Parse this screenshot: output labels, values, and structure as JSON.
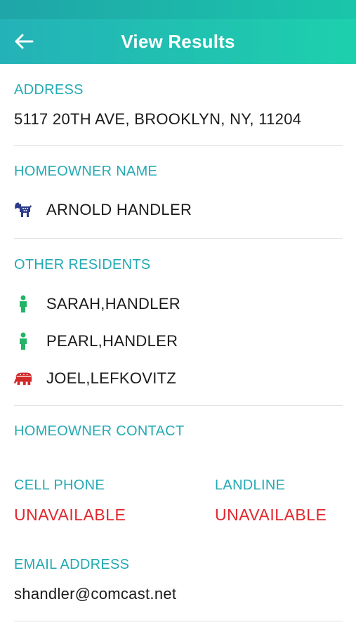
{
  "header": {
    "title": "View Results"
  },
  "address": {
    "label": "ADDRESS",
    "value": "5117 20TH AVE, BROOKLYN, NY, 11204"
  },
  "homeowner": {
    "label": "HOMEOWNER NAME",
    "name": "ARNOLD HANDLER",
    "party_icon": "democrat-donkey-icon"
  },
  "other_residents": {
    "label": "OTHER RESIDENTS",
    "items": [
      {
        "name": "SARAH,HANDLER",
        "icon": "person-icon"
      },
      {
        "name": "PEARL,HANDLER",
        "icon": "person-icon"
      },
      {
        "name": "JOEL,LEFKOVITZ",
        "icon": "republican-elephant-icon"
      }
    ]
  },
  "contact": {
    "label": "HOMEOWNER CONTACT",
    "cell_label": "CELL PHONE",
    "cell_value": "UNAVAILABLE",
    "landline_label": "LANDLINE",
    "landline_value": "UNAVAILABLE",
    "email_label": "EMAIL ADDRESS",
    "email_value": "shandler@comcast.net"
  },
  "colors": {
    "accent": "#23aab4",
    "header_start": "#24b2b8",
    "header_end": "#1dd0ad",
    "unavailable": "#e0282e",
    "democrat": "#2b3a8c",
    "republican": "#d22a2a",
    "person": "#22b365"
  }
}
